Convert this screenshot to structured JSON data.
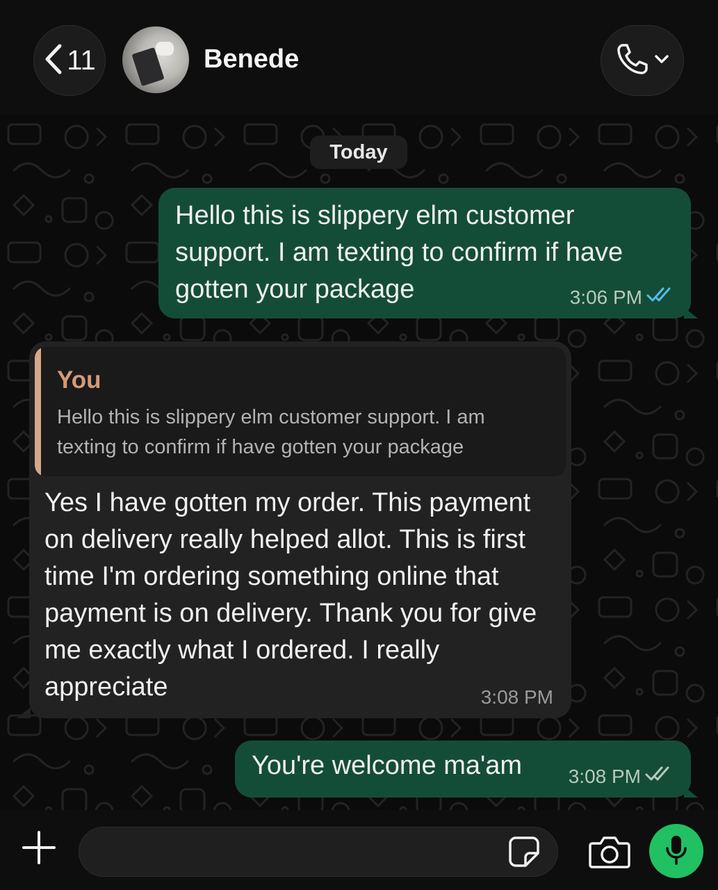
{
  "header": {
    "back_count": "11",
    "contact_name": "Benede"
  },
  "chat": {
    "date_label": "Today",
    "messages": [
      {
        "direction": "outgoing",
        "text": "Hello this is slippery elm customer support. I am texting to confirm if have gotten your package",
        "time": "3:06 PM",
        "status": "read"
      },
      {
        "direction": "incoming",
        "quote_author": "You",
        "quote_text": "Hello this is slippery elm customer support. I am texting to confirm if have gotten your package",
        "text": "Yes I have gotten my order. This payment on delivery really helped allot. This is first time I'm ordering something online that payment is on delivery. Thank you for give me exactly what I ordered. I really appreciate",
        "time": "3:08 PM"
      },
      {
        "direction": "outgoing",
        "text": "You're welcome ma'am",
        "time": "3:08 PM",
        "status": "delivered"
      }
    ]
  },
  "composer": {
    "placeholder": ""
  },
  "colors": {
    "outgoing_bubble": "#144d37",
    "incoming_bubble": "#222222",
    "read_tick": "#53bdeb",
    "quote_accent": "#d7a78a",
    "mic_button": "#21c063"
  },
  "icons": [
    "chevron-left-icon",
    "phone-icon",
    "chevron-down-icon",
    "double-check-icon",
    "plus-icon",
    "sticker-icon",
    "camera-icon",
    "microphone-icon"
  ]
}
